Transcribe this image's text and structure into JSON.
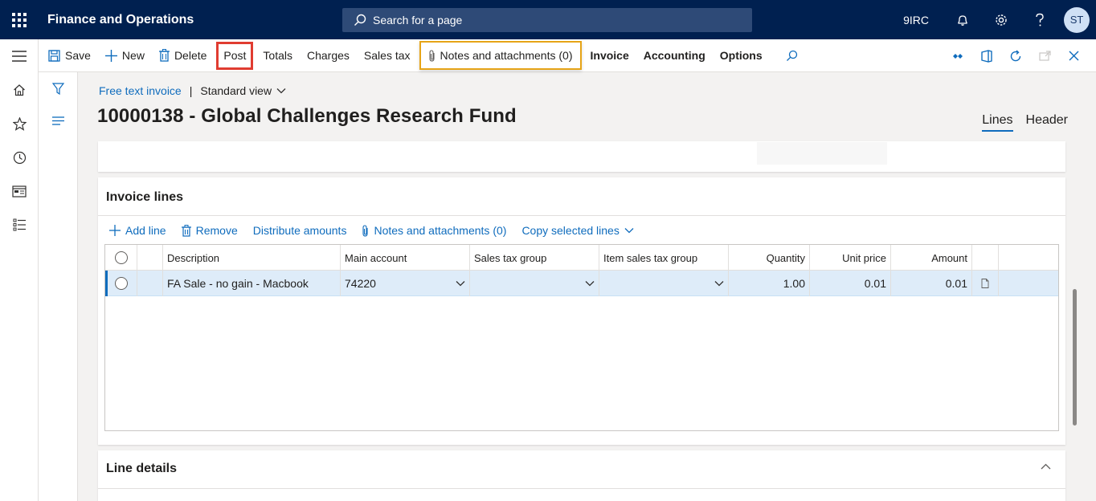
{
  "topbar": {
    "app_title": "Finance and Operations",
    "search_placeholder": "Search for a page",
    "company": "9IRC",
    "avatar_initials": "ST"
  },
  "actions": {
    "save": "Save",
    "new": "New",
    "delete": "Delete",
    "post": "Post",
    "totals": "Totals",
    "charges": "Charges",
    "sales_tax": "Sales tax",
    "notes": "Notes and attachments (0)",
    "invoice": "Invoice",
    "accounting": "Accounting",
    "options": "Options"
  },
  "breadcrumb": {
    "form": "Free text invoice",
    "separator": "|",
    "view": "Standard view"
  },
  "page": {
    "title": "10000138 - Global Challenges Research Fund",
    "tabs": [
      "Lines",
      "Header"
    ],
    "active_tab": "Lines"
  },
  "invoice_lines": {
    "title": "Invoice lines",
    "toolbar": {
      "add_line": "Add line",
      "remove": "Remove",
      "distribute": "Distribute amounts",
      "notes": "Notes and attachments (0)",
      "copy": "Copy selected lines"
    },
    "columns": {
      "description": "Description",
      "main_account": "Main account",
      "sales_tax_group": "Sales tax group",
      "item_sales_tax_group": "Item sales tax group",
      "quantity": "Quantity",
      "unit_price": "Unit price",
      "amount": "Amount"
    },
    "rows": [
      {
        "description": "FA Sale - no gain - Macbook",
        "main_account": "74220",
        "sales_tax_group": "",
        "item_sales_tax_group": "",
        "quantity": "1.00",
        "unit_price": "0.01",
        "amount": "0.01"
      }
    ]
  },
  "line_details": {
    "title": "Line details"
  },
  "colors": {
    "topbar": "#002050",
    "accent": "#0f6cbd",
    "post_highlight": "#e03c31",
    "notes_highlight": "#e6a417",
    "selected_row": "#deecf9"
  }
}
